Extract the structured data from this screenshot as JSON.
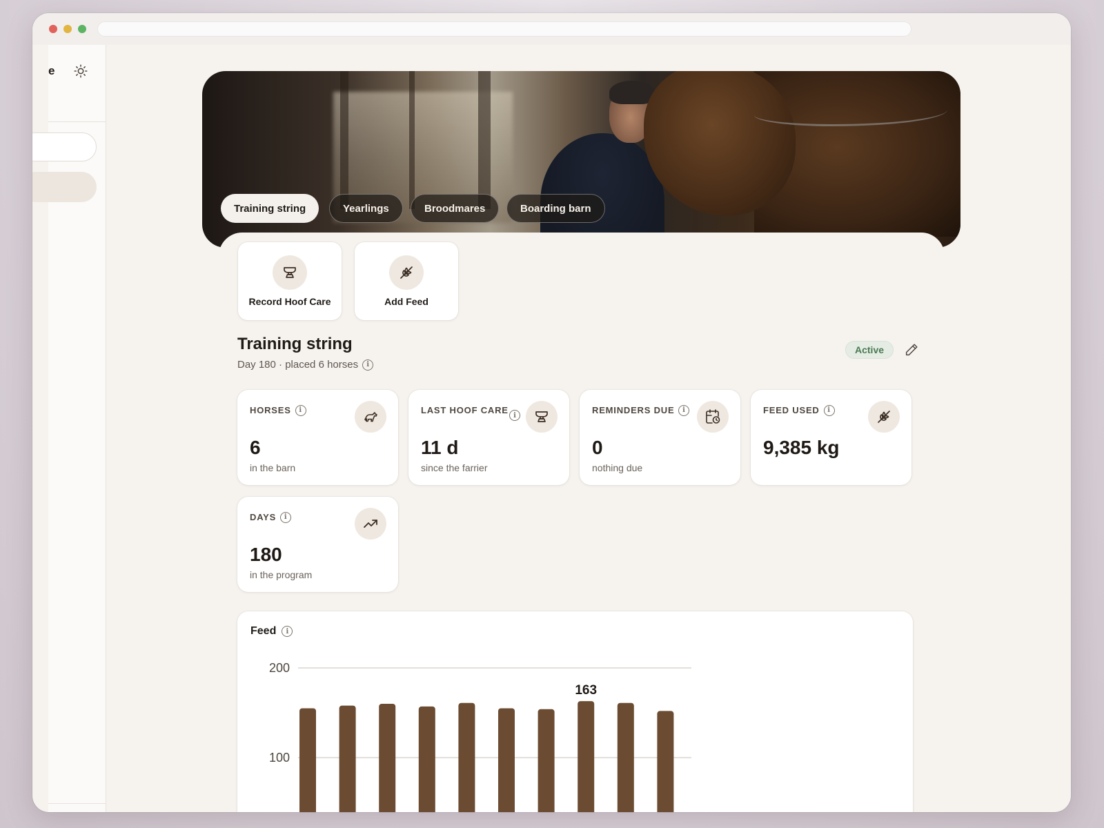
{
  "sidebar": {
    "brand_fragment": "e",
    "theme_icon": "sun-icon"
  },
  "tabs": [
    {
      "label": "Training string",
      "active": true
    },
    {
      "label": "Yearlings",
      "active": false
    },
    {
      "label": "Broodmares",
      "active": false
    },
    {
      "label": "Boarding barn",
      "active": false
    }
  ],
  "actions": [
    {
      "label": "Record Hoof Care",
      "icon": "anvil-icon"
    },
    {
      "label": "Add Feed",
      "icon": "wheat-icon"
    }
  ],
  "group": {
    "title": "Training string",
    "subtitle": "Day 180 · placed 6 horses",
    "status": "Active",
    "status_color": "#4a7a52"
  },
  "stats": [
    {
      "label": "HORSES",
      "value": "6",
      "sub": "in the barn",
      "icon": "horse-icon"
    },
    {
      "label": "LAST HOOF CARE",
      "value": "11 d",
      "sub": "since the farrier",
      "icon": "anvil-icon"
    },
    {
      "label": "REMINDERS DUE",
      "value": "0",
      "sub": "nothing due",
      "icon": "calendar-clock-icon"
    },
    {
      "label": "FEED USED",
      "value": "9,385 kg",
      "sub": "",
      "icon": "wheat-icon"
    },
    {
      "label": "DAYS",
      "value": "180",
      "sub": "in the program",
      "icon": "trending-up-icon"
    }
  ],
  "chart_title": "Feed",
  "chart_data": {
    "type": "bar",
    "title": "Feed",
    "categories": [
      "",
      "",
      "",
      "",
      "",
      "",
      "",
      "",
      "",
      ""
    ],
    "values": [
      155,
      158,
      160,
      157,
      161,
      155,
      154,
      163,
      161,
      152
    ],
    "yticks": [
      "200",
      "100"
    ],
    "ylim": [
      0,
      200
    ],
    "highlight_label": "163",
    "highlight_index": 7,
    "bar_color": "#6b4c32"
  },
  "colors": {
    "accent": "#6b4c32",
    "page_bg": "#f6f3ef",
    "icon_bg": "#efe8e0"
  }
}
